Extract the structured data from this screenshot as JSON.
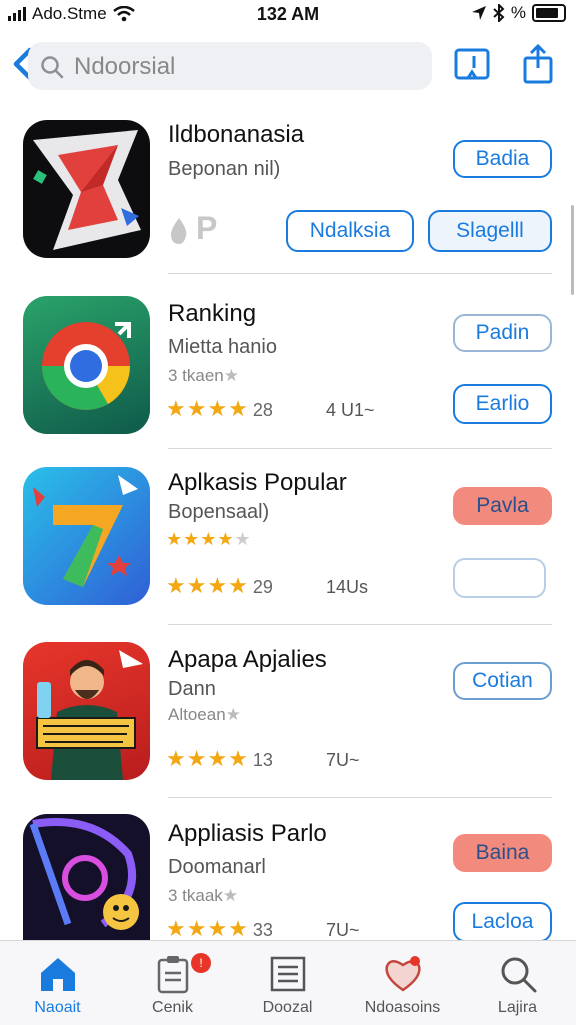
{
  "status": {
    "carrier": "Ado.Stme",
    "time": "132 AM",
    "right_text": "%"
  },
  "search": {
    "value": "Ndoorsial"
  },
  "apps": [
    {
      "title": "Ildbonanasia",
      "subtitle": "Beponan nil)",
      "extra": "P",
      "button_primary": "Badia",
      "buttons": [
        "Ndalksia",
        "Slagelll"
      ]
    },
    {
      "title": "Ranking",
      "subtitle": "Mietta hanio",
      "small": "3 tkaen",
      "rating_num": "28",
      "meta": "4 U1~",
      "button_primary": "Padin",
      "button_secondary": "Earlio"
    },
    {
      "title": "Aplkasis Popular",
      "subtitle": "Bopensaal)",
      "rating_num": "29",
      "meta": "14Us",
      "button_primary": "Pavla",
      "button_secondary": ""
    },
    {
      "title": "Apapa Apjalies",
      "subtitle": "Dann",
      "small": "Altoean",
      "rating_num": "13",
      "meta": "7U~",
      "button_primary": "Cotian"
    },
    {
      "title": "Appliasis Parlo",
      "subtitle": "Doomanarl",
      "small": "3 tkaak",
      "rating_num": "33",
      "meta": "7U~",
      "button_primary": "Baina",
      "button_secondary": "Lacloa"
    }
  ],
  "tabs": [
    {
      "label": "Naoait",
      "icon": "home-icon"
    },
    {
      "label": "Cenik",
      "icon": "clipboard-icon",
      "badge": "!"
    },
    {
      "label": "Doozal",
      "icon": "document-list-icon"
    },
    {
      "label": "Ndoasoins",
      "icon": "heart-icon"
    },
    {
      "label": "Lajira",
      "icon": "search-icon"
    }
  ],
  "colors": {
    "accent": "#1a7bdf",
    "star": "#f3a712",
    "red_button": "#f28b7d"
  }
}
